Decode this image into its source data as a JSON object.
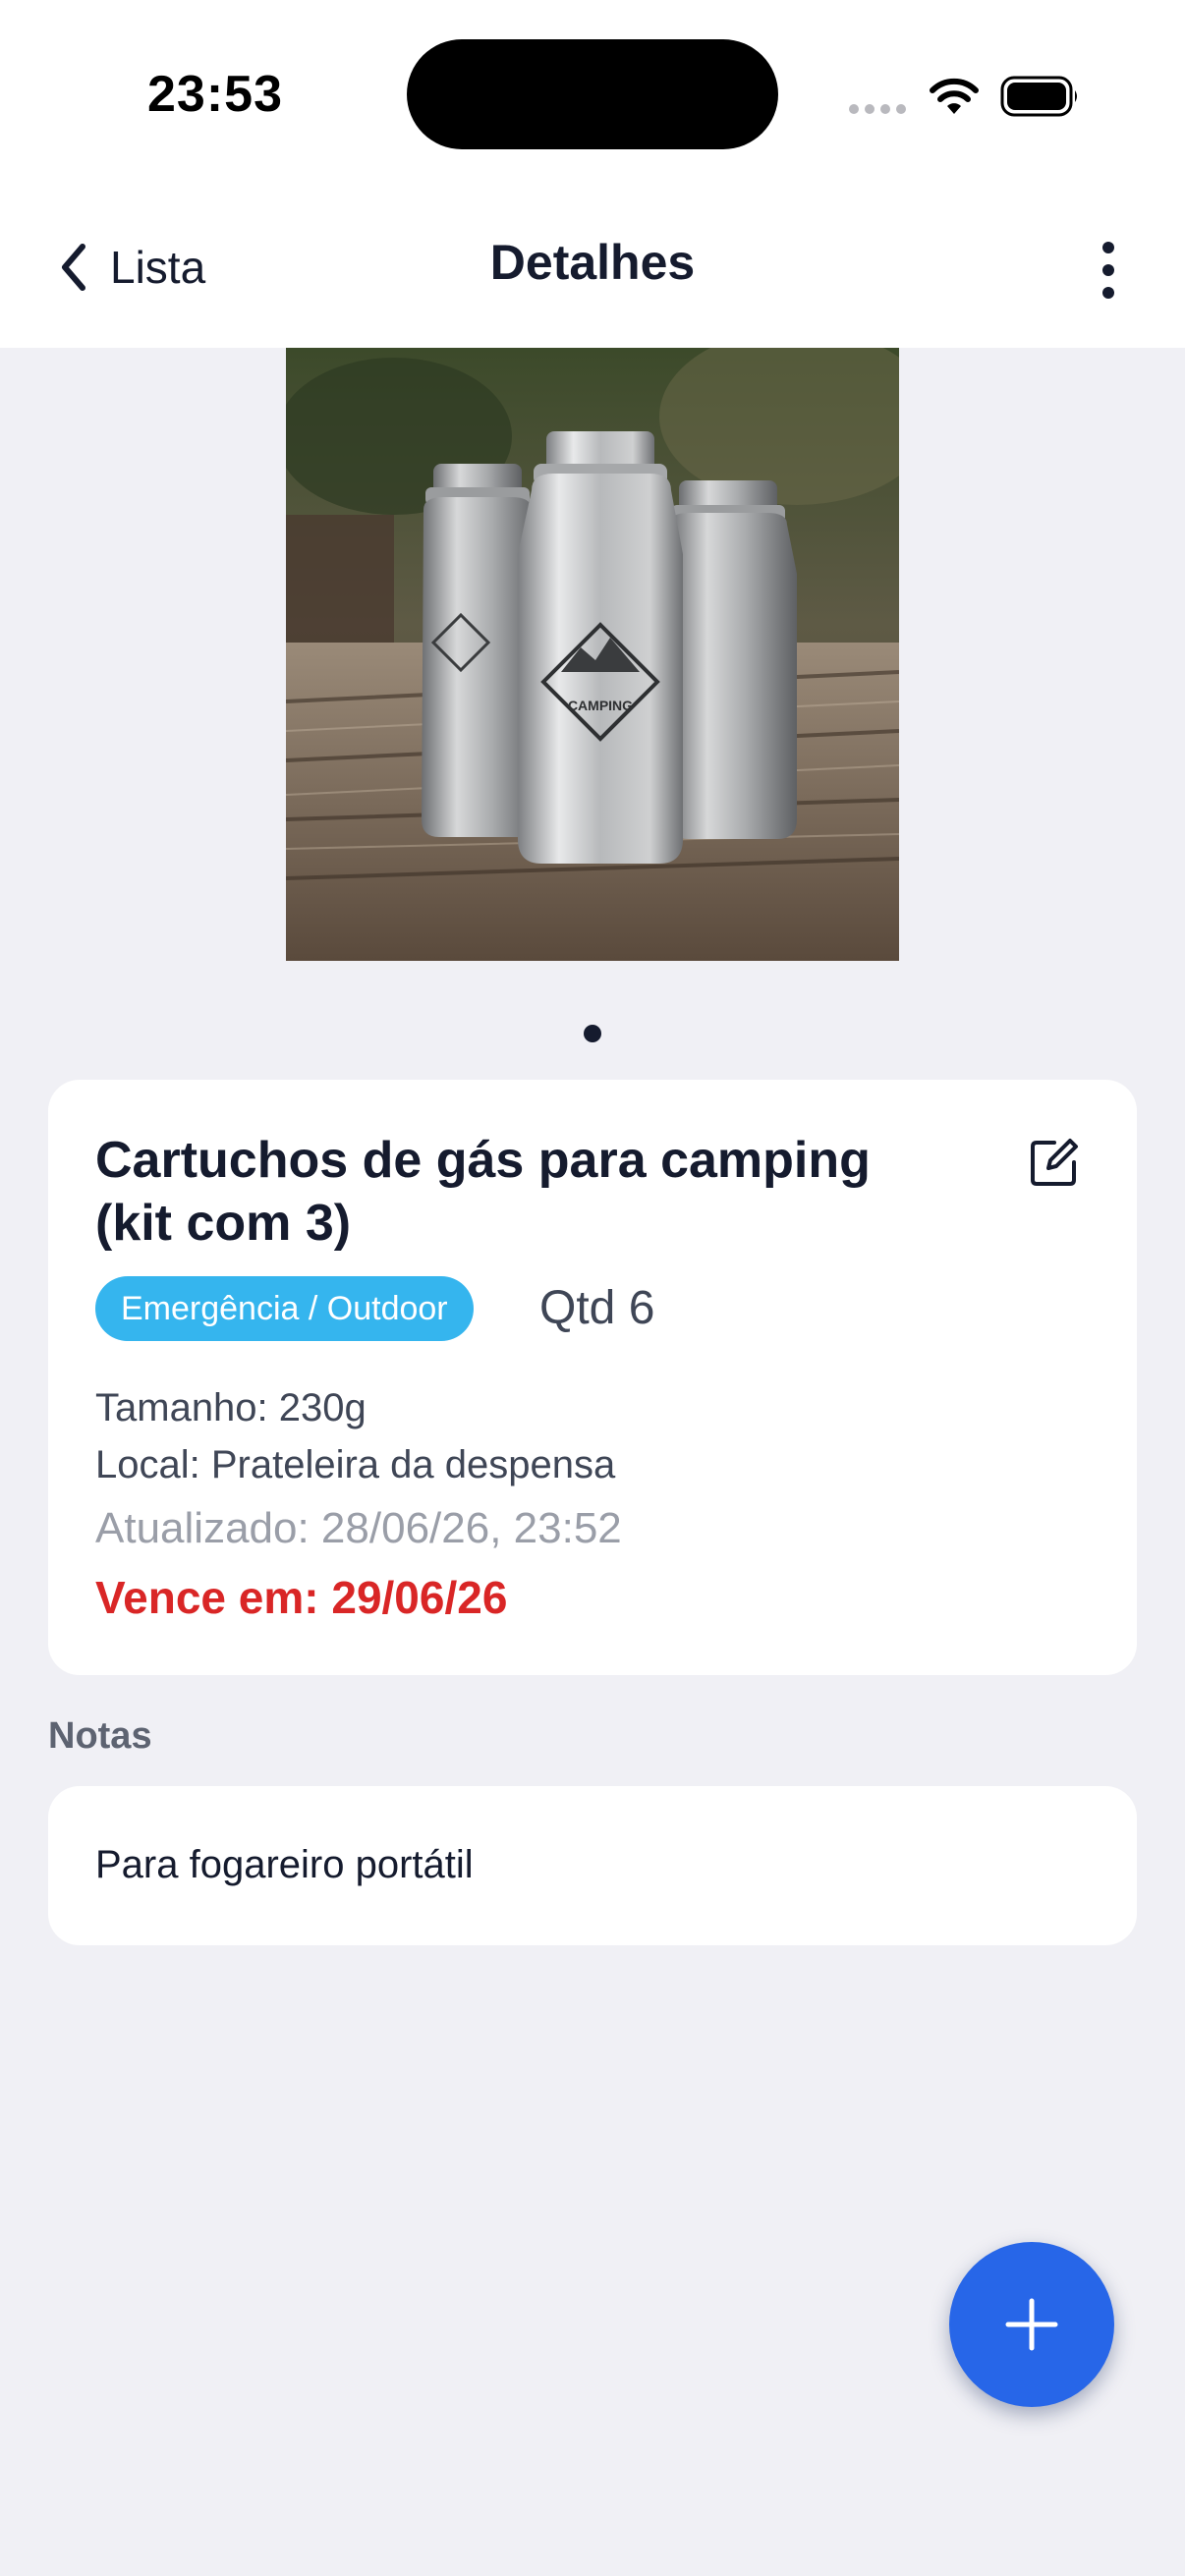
{
  "status_bar": {
    "time": "23:53"
  },
  "nav": {
    "back_label": "Lista",
    "title": "Detalhes"
  },
  "item": {
    "title_line1": "Cartuchos de gás para camping",
    "title_line2": "(kit com 3)",
    "category_tag": "Emergência / Outdoor",
    "quantity": "Qtd 6",
    "size": "Tamanho: 230g",
    "location": "Local: Prateleira da despensa",
    "updated": "Atualizado: 28/06/26, 23:52",
    "expires": "Vence em: 29/06/26",
    "photo_label": "CAMPING",
    "photo_count": 1,
    "photo_index": 1
  },
  "notes": {
    "heading": "Notas",
    "text": "Para fogareiro portátil"
  },
  "colors": {
    "background": "#f0f0f5",
    "tag": "#35b5ee",
    "expires": "#d92626",
    "fab": "#2766e8"
  },
  "icons": {
    "back": "chevron-left-icon",
    "more": "more-vertical-icon",
    "edit": "edit-icon",
    "fab": "plus-icon"
  }
}
